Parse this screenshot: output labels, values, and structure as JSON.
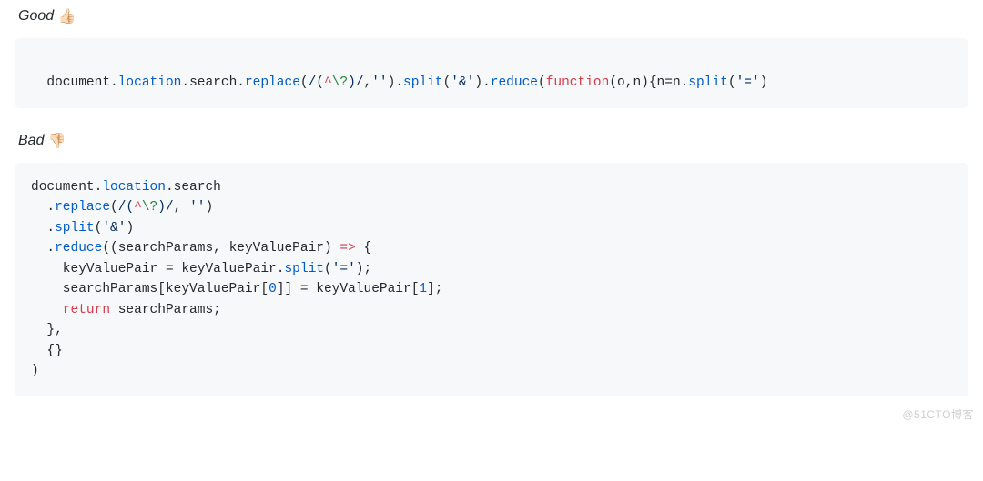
{
  "good": {
    "label": "Good",
    "emoji": "👍🏻",
    "code": {
      "tokens": [
        {
          "t": "document",
          "c": "tok-ident"
        },
        {
          "t": ".",
          "c": "tok-punct"
        },
        {
          "t": "location",
          "c": "tok-prop"
        },
        {
          "t": ".",
          "c": "tok-punct"
        },
        {
          "t": "search",
          "c": "tok-ident"
        },
        {
          "t": ".",
          "c": "tok-punct"
        },
        {
          "t": "replace",
          "c": "tok-prop"
        },
        {
          "t": "(",
          "c": "tok-punct"
        },
        {
          "t": "/(",
          "c": "tok-regex"
        },
        {
          "t": "^",
          "c": "tok-caret"
        },
        {
          "t": "\\?",
          "c": "tok-esc"
        },
        {
          "t": ")/",
          "c": "tok-regex"
        },
        {
          "t": ",",
          "c": "tok-punct"
        },
        {
          "t": "''",
          "c": "tok-str"
        },
        {
          "t": ").",
          "c": "tok-punct"
        },
        {
          "t": "split",
          "c": "tok-prop"
        },
        {
          "t": "(",
          "c": "tok-punct"
        },
        {
          "t": "'&'",
          "c": "tok-str"
        },
        {
          "t": ").",
          "c": "tok-punct"
        },
        {
          "t": "reduce",
          "c": "tok-prop"
        },
        {
          "t": "(",
          "c": "tok-punct"
        },
        {
          "t": "function",
          "c": "tok-kw"
        },
        {
          "t": "(",
          "c": "tok-punct"
        },
        {
          "t": "o",
          "c": "tok-ident"
        },
        {
          "t": ",",
          "c": "tok-punct"
        },
        {
          "t": "n",
          "c": "tok-ident"
        },
        {
          "t": "){",
          "c": "tok-punct"
        },
        {
          "t": "n",
          "c": "tok-ident"
        },
        {
          "t": "=",
          "c": "tok-punct"
        },
        {
          "t": "n",
          "c": "tok-ident"
        },
        {
          "t": ".",
          "c": "tok-punct"
        },
        {
          "t": "split",
          "c": "tok-prop"
        },
        {
          "t": "(",
          "c": "tok-punct"
        },
        {
          "t": "'='",
          "c": "tok-str"
        },
        {
          "t": ")",
          "c": "tok-punct"
        }
      ]
    }
  },
  "bad": {
    "label": "Bad",
    "emoji": "👎🏻",
    "code": {
      "lines": [
        [
          {
            "t": "document",
            "c": "tok-ident"
          },
          {
            "t": ".",
            "c": "tok-punct"
          },
          {
            "t": "location",
            "c": "tok-prop"
          },
          {
            "t": ".",
            "c": "tok-punct"
          },
          {
            "t": "search",
            "c": "tok-ident"
          }
        ],
        [
          {
            "t": "  .",
            "c": "tok-punct"
          },
          {
            "t": "replace",
            "c": "tok-prop"
          },
          {
            "t": "(",
            "c": "tok-punct"
          },
          {
            "t": "/(",
            "c": "tok-regex"
          },
          {
            "t": "^",
            "c": "tok-caret"
          },
          {
            "t": "\\?",
            "c": "tok-esc"
          },
          {
            "t": ")/",
            "c": "tok-regex"
          },
          {
            "t": ", ",
            "c": "tok-punct"
          },
          {
            "t": "''",
            "c": "tok-str"
          },
          {
            "t": ")",
            "c": "tok-punct"
          }
        ],
        [
          {
            "t": "  .",
            "c": "tok-punct"
          },
          {
            "t": "split",
            "c": "tok-prop"
          },
          {
            "t": "(",
            "c": "tok-punct"
          },
          {
            "t": "'&'",
            "c": "tok-str"
          },
          {
            "t": ")",
            "c": "tok-punct"
          }
        ],
        [
          {
            "t": "  .",
            "c": "tok-punct"
          },
          {
            "t": "reduce",
            "c": "tok-prop"
          },
          {
            "t": "((",
            "c": "tok-punct"
          },
          {
            "t": "searchParams",
            "c": "tok-ident"
          },
          {
            "t": ", ",
            "c": "tok-punct"
          },
          {
            "t": "keyValuePair",
            "c": "tok-ident"
          },
          {
            "t": ") ",
            "c": "tok-punct"
          },
          {
            "t": "=>",
            "c": "tok-kw"
          },
          {
            "t": " {",
            "c": "tok-punct"
          }
        ],
        [
          {
            "t": "    keyValuePair ",
            "c": "tok-ident"
          },
          {
            "t": "= ",
            "c": "tok-punct"
          },
          {
            "t": "keyValuePair",
            "c": "tok-ident"
          },
          {
            "t": ".",
            "c": "tok-punct"
          },
          {
            "t": "split",
            "c": "tok-prop"
          },
          {
            "t": "(",
            "c": "tok-punct"
          },
          {
            "t": "'='",
            "c": "tok-str"
          },
          {
            "t": ");",
            "c": "tok-punct"
          }
        ],
        [
          {
            "t": "    searchParams",
            "c": "tok-ident"
          },
          {
            "t": "[",
            "c": "tok-punct"
          },
          {
            "t": "keyValuePair",
            "c": "tok-ident"
          },
          {
            "t": "[",
            "c": "tok-punct"
          },
          {
            "t": "0",
            "c": "tok-num"
          },
          {
            "t": "]] = ",
            "c": "tok-punct"
          },
          {
            "t": "keyValuePair",
            "c": "tok-ident"
          },
          {
            "t": "[",
            "c": "tok-punct"
          },
          {
            "t": "1",
            "c": "tok-num"
          },
          {
            "t": "];",
            "c": "tok-punct"
          }
        ],
        [
          {
            "t": "    ",
            "c": "tok-punct"
          },
          {
            "t": "return",
            "c": "tok-kw"
          },
          {
            "t": " searchParams;",
            "c": "tok-ident"
          }
        ],
        [
          {
            "t": "  },",
            "c": "tok-punct"
          }
        ],
        [
          {
            "t": "  {}",
            "c": "tok-punct"
          }
        ],
        [
          {
            "t": ")",
            "c": "tok-punct"
          }
        ]
      ]
    }
  },
  "watermark": "@51CTO博客"
}
